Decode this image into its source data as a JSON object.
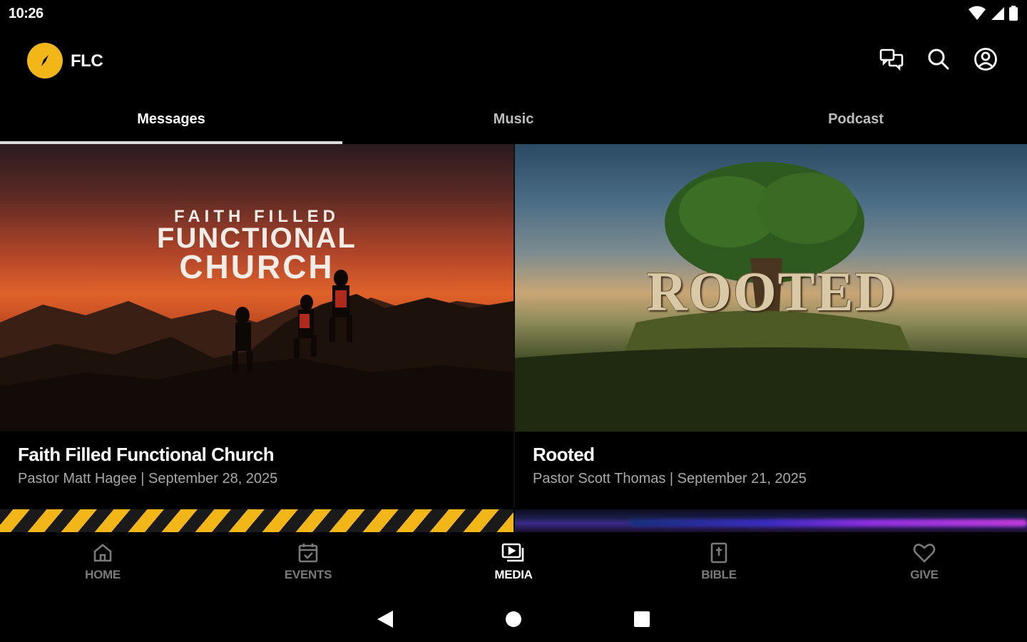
{
  "status": {
    "time": "10:26"
  },
  "app": {
    "title": "FLC"
  },
  "tabs": [
    {
      "label": "Messages",
      "active": true
    },
    {
      "label": "Music",
      "active": false
    },
    {
      "label": "Podcast",
      "active": false
    }
  ],
  "cards": [
    {
      "title": "Faith Filled Functional Church",
      "subtitle": "Pastor Matt Hagee | September 28, 2025",
      "artwork_text": [
        "FAITH FILLED",
        "FUNCTIONAL",
        "CHURCH"
      ]
    },
    {
      "title": "Rooted",
      "subtitle": "Pastor Scott Thomas | September 21, 2025",
      "artwork_text": [
        "ROOTED"
      ]
    }
  ],
  "bottom_nav": [
    {
      "label": "HOME",
      "icon": "home-icon",
      "active": false
    },
    {
      "label": "EVENTS",
      "icon": "calendar-icon",
      "active": false
    },
    {
      "label": "MEDIA",
      "icon": "media-icon",
      "active": true
    },
    {
      "label": "BIBLE",
      "icon": "bible-icon",
      "active": false
    },
    {
      "label": "GIVE",
      "icon": "heart-icon",
      "active": false
    }
  ],
  "colors": {
    "accent": "#f2b619",
    "background": "#000000",
    "subtitle": "#a8a8a8"
  }
}
